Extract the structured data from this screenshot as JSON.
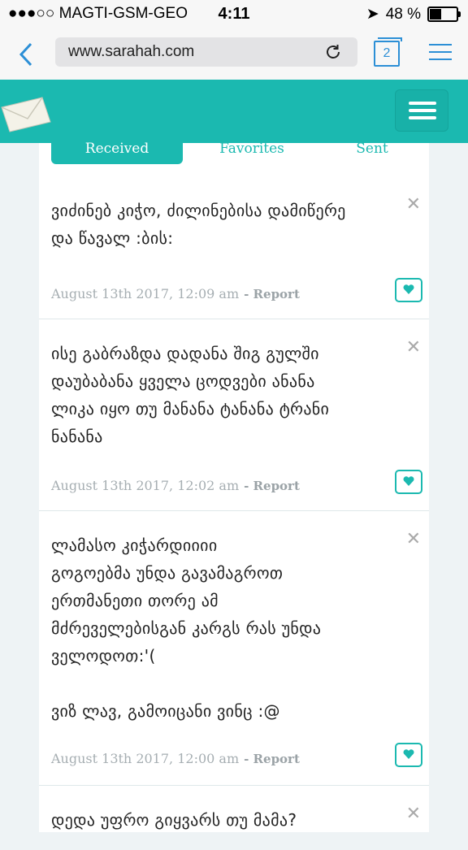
{
  "status_bar": {
    "carrier": "●●●○○ MAGTI-GSM-GEO",
    "time": "4:11",
    "battery_pct": "48 %"
  },
  "browser": {
    "url": "www.sarahah.com",
    "tab_count": "2"
  },
  "tabs": [
    {
      "label": "Received",
      "active": true
    },
    {
      "label": "Favorites",
      "active": false
    },
    {
      "label": "Sent",
      "active": false
    }
  ],
  "messages": [
    {
      "text": "ვიძინებ კიჭო, ძილინებისა დამიწერე\nდა წავალ :ბის:",
      "date": "August 13th 2017, 12:09 am",
      "report_label": "- Report"
    },
    {
      "text": "ისე გაბრაზდა დადანა შიგ გულში\nდაუბაბანა ყველა ცოდვები ანანა\nლიკა იყო თუ მანანა ტანანა ტრანი\nნანანა",
      "date": "August 13th 2017, 12:02 am",
      "report_label": "- Report"
    },
    {
      "text": "ლამასო კიჭარდიიიი\nგოგოებმა უნდა გავამაგროთ\nერთმანეთი თორე ამ\nმძრეველებისგან კარგს რას უნდა\nველოდოთ:'(\n\nვიზ ლავ, გამოიცანი ვინც :@",
      "date": "August 13th 2017, 12:00 am",
      "report_label": "- Report"
    },
    {
      "text": "დედა უფრო გიყვარს თუ მამა?",
      "date": "",
      "report_label": ""
    }
  ],
  "colors": {
    "accent": "#1bb9b0",
    "link_blue": "#2c8fd6"
  }
}
